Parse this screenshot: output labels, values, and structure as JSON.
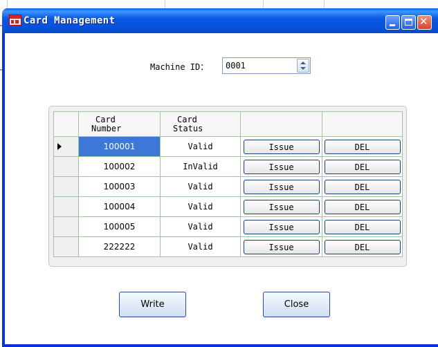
{
  "window": {
    "title": "Card Management"
  },
  "form": {
    "machine_id_label": "Machine ID：",
    "machine_id_value": "0001"
  },
  "table": {
    "columns": [
      "Card Number",
      "Card Status",
      "",
      ""
    ],
    "column_header_lines": [
      [
        "Card",
        "Number"
      ],
      [
        "Card",
        "Status"
      ]
    ],
    "selected_row": 0,
    "rows": [
      {
        "number": "100001",
        "status": "Valid",
        "issue": "Issue",
        "del": "DEL"
      },
      {
        "number": "100002",
        "status": "InValid",
        "issue": "Issue",
        "del": "DEL"
      },
      {
        "number": "100003",
        "status": "Valid",
        "issue": "Issue",
        "del": "DEL"
      },
      {
        "number": "100004",
        "status": "Valid",
        "issue": "Issue",
        "del": "DEL"
      },
      {
        "number": "100005",
        "status": "Valid",
        "issue": "Issue",
        "del": "DEL"
      },
      {
        "number": "222222",
        "status": "Valid",
        "issue": "Issue",
        "del": "DEL"
      }
    ]
  },
  "buttons": {
    "write": "Write",
    "close": "Close"
  },
  "colors": {
    "titlebar": "#0a58e4",
    "selection": "#3d78d7",
    "grid_line": "#9fc49f"
  },
  "icons": [
    "app-icon",
    "minimize-icon",
    "maximize-icon",
    "close-icon",
    "spin-up-icon",
    "spin-down-icon",
    "row-indicator-icon"
  ]
}
